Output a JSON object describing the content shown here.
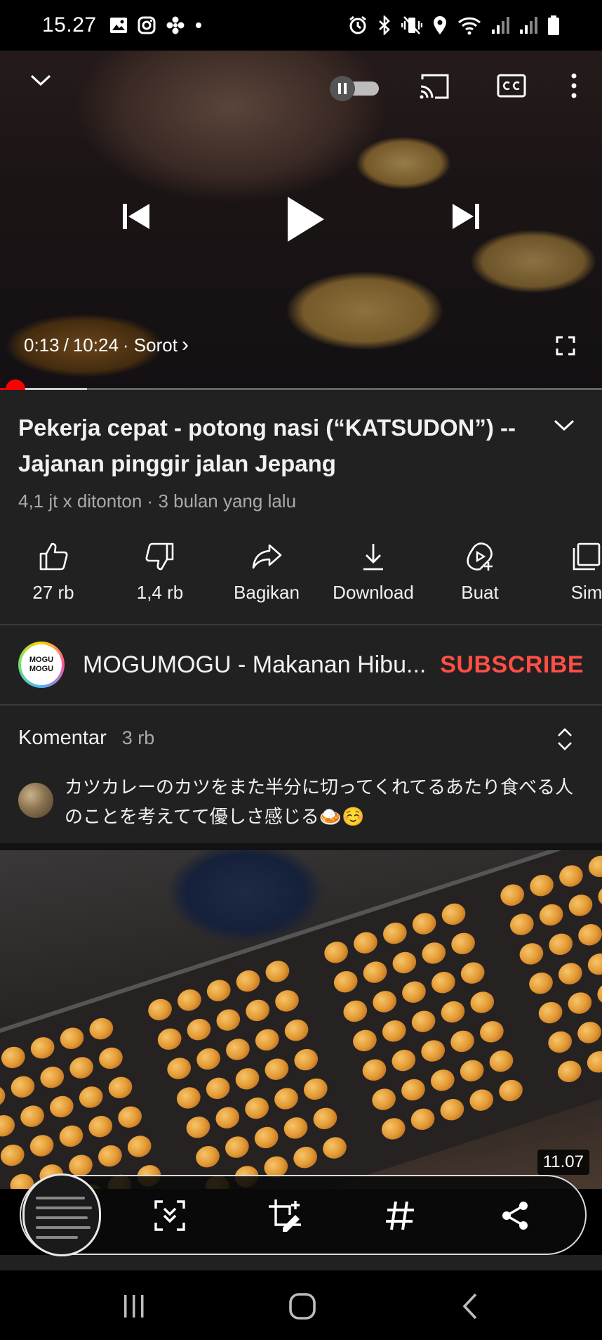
{
  "status_bar": {
    "time": "15.27",
    "left_icons": [
      "image-icon",
      "instagram-icon",
      "fan-icon",
      "dot-icon"
    ],
    "right_icons": [
      "alarm-icon",
      "bluetooth-icon",
      "vibrate-icon",
      "location-icon",
      "wifi-icon",
      "signal-icon",
      "signal-icon",
      "battery-icon"
    ]
  },
  "player": {
    "current_time": "0:13",
    "separator": "/",
    "duration": "10:24",
    "chapter": "· Sorot",
    "chapter_chevron": "›",
    "progress_played": 0.021,
    "progress_buffered": 0.145,
    "icons": [
      "chevron-down-icon",
      "autoplay-toggle-icon",
      "cast-icon",
      "cc-icon",
      "more-icon",
      "previous-icon",
      "play-icon",
      "next-icon",
      "fullscreen-icon"
    ]
  },
  "video": {
    "title": "Pekerja cepat - potong nasi (“KATSUDON”) --Jajanan pinggir jalan Jepang",
    "meta": "4,1 jt x ditonton · 3 bulan yang lalu"
  },
  "actions": [
    {
      "icon": "like-icon",
      "label": "27 rb"
    },
    {
      "icon": "dislike-icon",
      "label": "1,4 rb"
    },
    {
      "icon": "share-icon",
      "label": "Bagikan"
    },
    {
      "icon": "download-icon",
      "label": "Download"
    },
    {
      "icon": "create-icon",
      "label": "Buat"
    },
    {
      "icon": "save-icon",
      "label": "Sim"
    }
  ],
  "channel": {
    "avatar_text": "MOGU MOGU",
    "name": "MOGUMOGU - Makanan Hibu...",
    "subscribe_label": "SUBSCRIBE"
  },
  "comments": {
    "title": "Komentar",
    "count": "3 rb",
    "top_comment": "カツカレーのカツをまた半分に切ってくれてるあたり食べる人のことを考えてて優しさ感じる🍛☺️"
  },
  "next_video": {
    "duration": "11.07"
  },
  "screenshot_toolbar": {
    "buttons": [
      "scroll-capture-icon",
      "crop-edit-icon",
      "hashtag-icon",
      "share-icon"
    ]
  },
  "nav_bar": {
    "buttons": [
      "recent-apps-icon",
      "home-icon",
      "back-icon"
    ]
  },
  "colors": {
    "background": "#212121",
    "subscribe": "#ff4e45",
    "progress": "#ff0000",
    "secondary_text": "#aaaaaa"
  }
}
